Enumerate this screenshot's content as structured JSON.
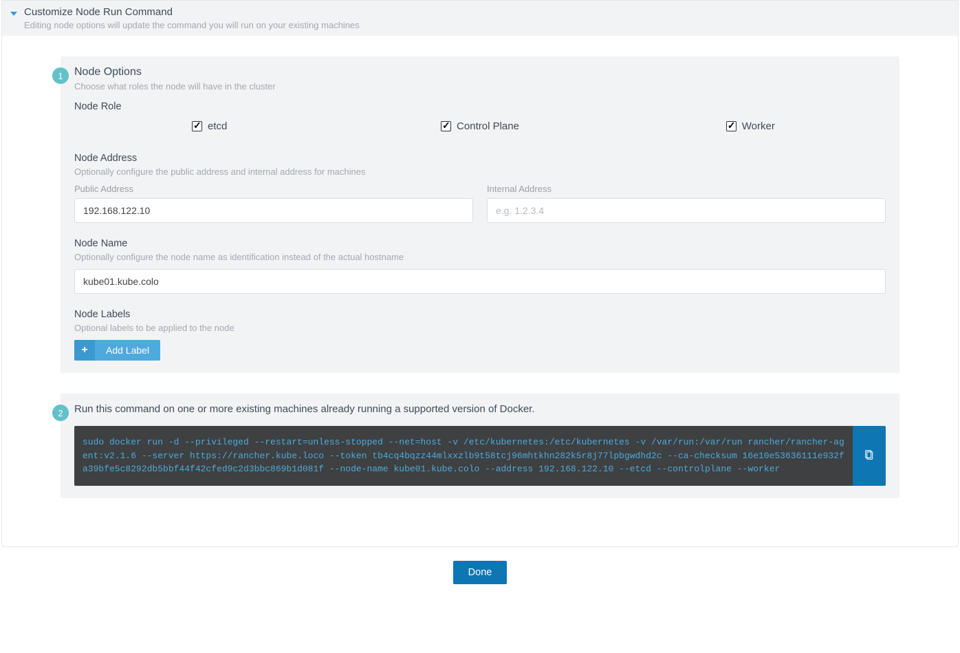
{
  "header": {
    "title": "Customize Node Run Command",
    "subtitle": "Editing node options will update the command you will run on your existing machines"
  },
  "step1": {
    "badge": "1",
    "title": "Node Options",
    "subtitle": "Choose what roles the node will have in the cluster",
    "role_label": "Node Role",
    "roles": {
      "etcd": "etcd",
      "control": "Control Plane",
      "worker": "Worker"
    },
    "address_label": "Node Address",
    "address_desc": "Optionally configure the public address and internal address for machines",
    "public_label": "Public Address",
    "public_value": "192.168.122.10",
    "internal_label": "Internal Address",
    "internal_placeholder": "e.g. 1.2.3.4",
    "name_label": "Node Name",
    "name_desc": "Optionally configure the node name as identification instead of the actual hostname",
    "name_value": "kube01.kube.colo",
    "labels_label": "Node Labels",
    "labels_desc": "Optional labels to be applied to the node",
    "add_label_btn": "Add Label"
  },
  "step2": {
    "badge": "2",
    "title": "Run this command on one or more existing machines already running a supported version of Docker.",
    "command": "sudo docker run -d --privileged --restart=unless-stopped --net=host -v /etc/kubernetes:/etc/kubernetes -v /var/run:/var/run rancher/rancher-agent:v2.1.6 --server https://rancher.kube.loco --token tb4cq4bqzz44mlxxzlb9t58tcj96mhtkhn282k5r8j77lpbgwdhd2c --ca-checksum 16e10e53636111e932fa39bfe5c8292db5bbf44f42cfed9c2d3bbc869b1d081f --node-name kube01.kube.colo --address 192.168.122.10 --etcd --controlplane --worker"
  },
  "done": "Done"
}
